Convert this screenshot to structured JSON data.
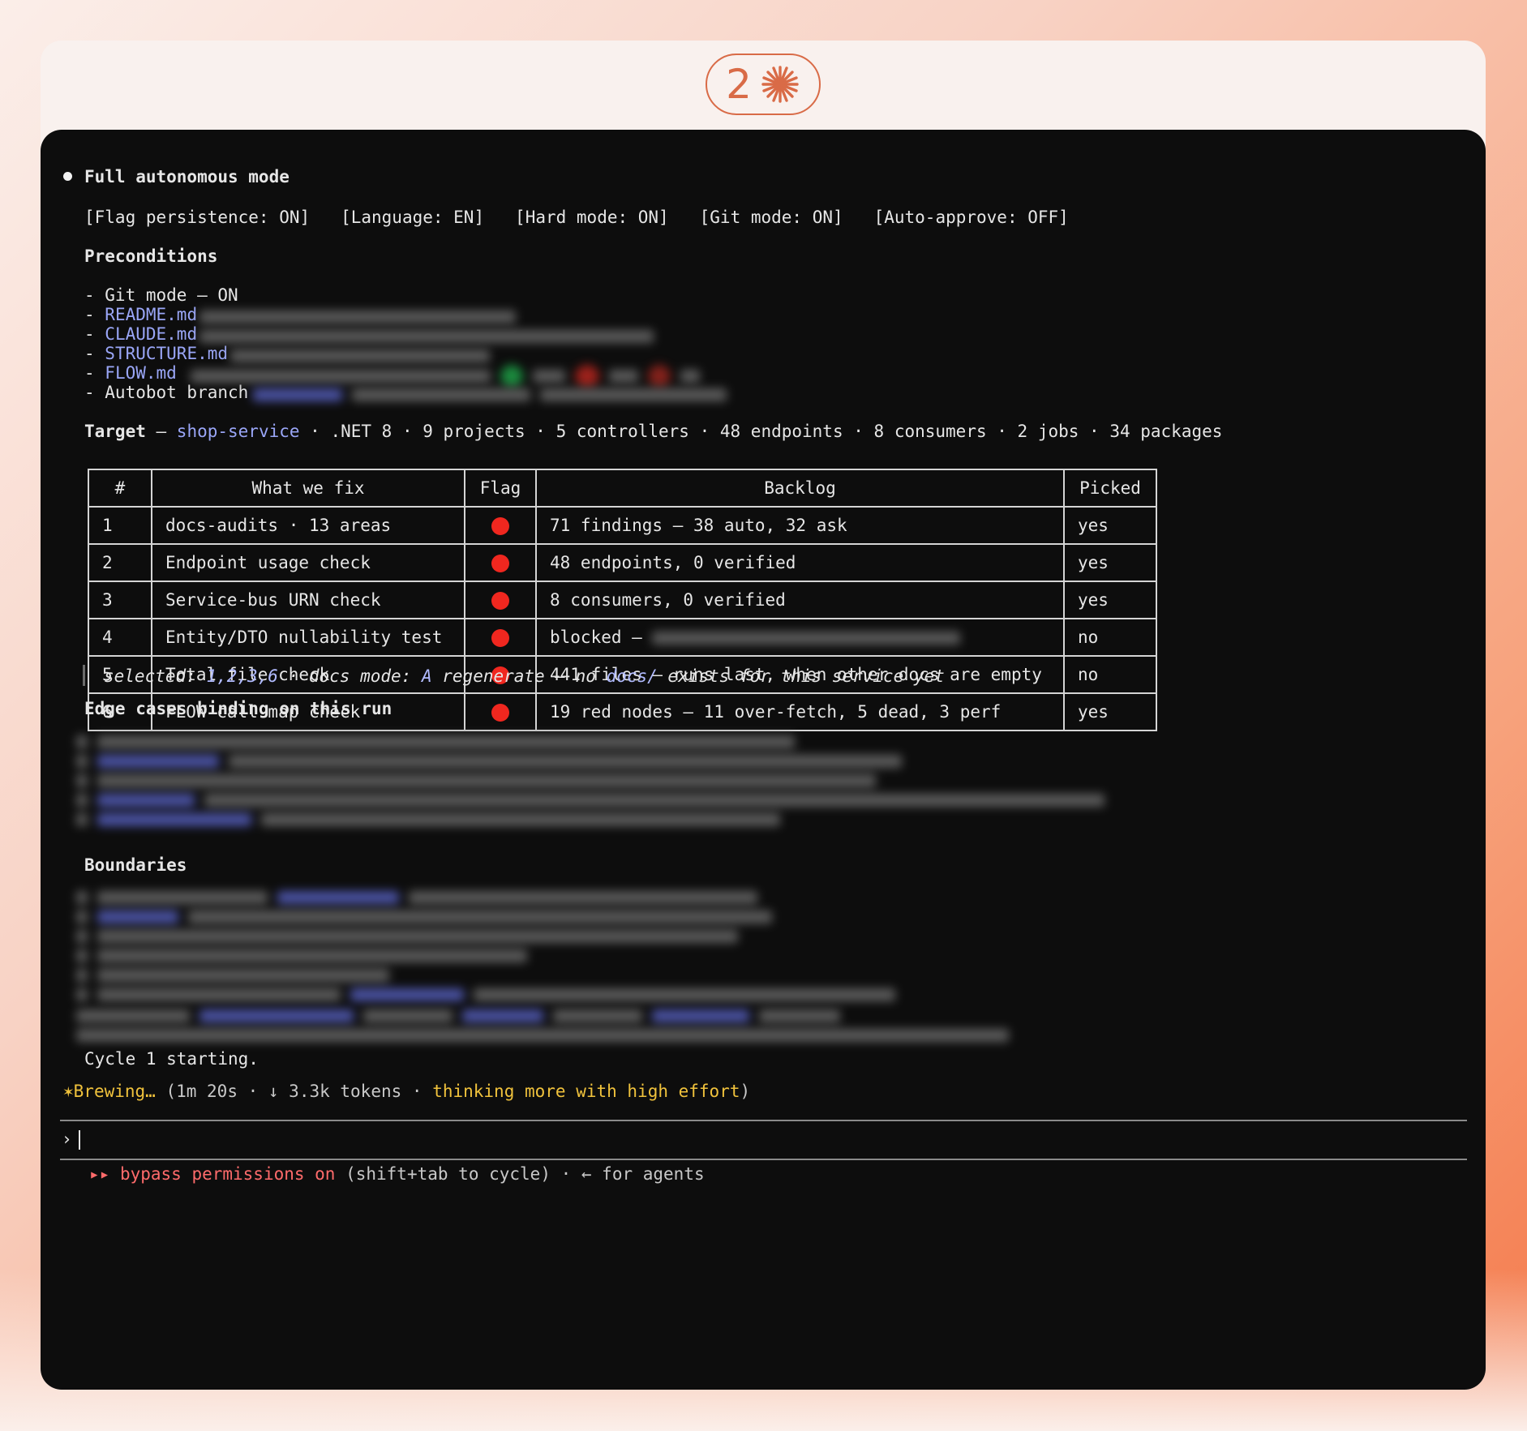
{
  "badge": {
    "number": "2"
  },
  "session": {
    "title": "Full autonomous mode",
    "flags": [
      "[Flag persistence: ON]",
      "[Language: EN]",
      "[Hard mode: ON]",
      "[Git mode: ON]",
      "[Auto-approve: OFF]"
    ]
  },
  "preconditions": {
    "heading": "Preconditions",
    "git_mode": "- Git mode — ON",
    "files": [
      "README.md",
      "CLAUDE.md",
      "STRUCTURE.md",
      "FLOW.md"
    ],
    "dash": "- ",
    "autobot": "- Autobot branch"
  },
  "target": {
    "label": "Target",
    "sep": " — ",
    "service": "shop-service",
    "stats": " · .NET 8 · 9 projects · 5 controllers · 48 endpoints · 8 consumers · 2 jobs · 34 packages"
  },
  "table": {
    "headers": [
      "#",
      "What we fix",
      "Flag",
      "Backlog",
      "Picked"
    ],
    "rows": [
      {
        "n": "1",
        "fix": "docs-audits · 13 areas",
        "backlog": "71 findings — 38 auto, 32 ask",
        "picked": "yes"
      },
      {
        "n": "2",
        "fix": "Endpoint usage check",
        "backlog": "48 endpoints, 0 verified",
        "picked": "yes"
      },
      {
        "n": "3",
        "fix": "Service-bus URN check",
        "backlog": "8 consumers, 0 verified",
        "picked": "yes"
      },
      {
        "n": "4",
        "fix": "Entity/DTO nullability test",
        "backlog": "blocked —",
        "picked": "no"
      },
      {
        "n": "5",
        "fix": "Total file check",
        "backlog": "441 files — runs last, when other docs are empty",
        "picked": "no"
      },
      {
        "n": "6",
        "fix": "FLOW call-map check",
        "backlog": "19 red nodes — 11 over-fetch, 5 dead, 3 perf",
        "picked": "yes"
      }
    ]
  },
  "selection": {
    "selected_label": "selected: ",
    "selected_value": "1,2,3,6",
    "mode_label": " · docs mode: ",
    "mode_value": "A",
    "mode_text": " regenerate — no ",
    "docs_path": "docs/",
    "tail": " exists for this service yet"
  },
  "edge_cases": {
    "heading": "Edge cases binding on this run"
  },
  "boundaries": {
    "heading": "Boundaries"
  },
  "cycle": "Cycle 1 starting.",
  "status": {
    "star": "✶",
    "verb": "Brewing…",
    "open": " (1m 20s · ↓ 3.3k tokens · ",
    "thinking": "thinking more with high effort",
    "close": ")"
  },
  "prompt": {
    "symbol": "›"
  },
  "footer": {
    "arrows": "▸▸",
    "mode": " bypass permissions on",
    "hint": " (shift+tab to cycle) · ← for agents"
  },
  "colors": {
    "accent": "#d96b47",
    "link": "#9aa6f7",
    "flag_red": "#f0271f",
    "status_yellow": "#f0c23c",
    "bypass_red": "#ff6b6b",
    "terminal_bg": "#0d0d0d"
  }
}
